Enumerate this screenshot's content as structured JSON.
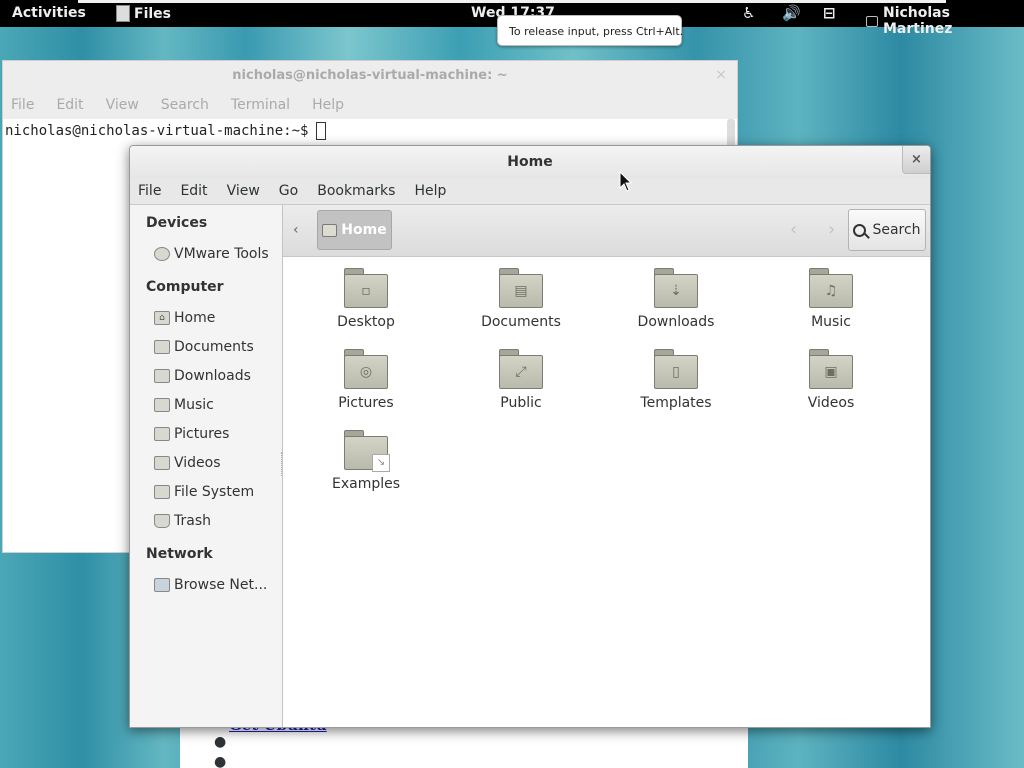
{
  "topbar": {
    "activities": "Activities",
    "app_menu": "Files",
    "clock": "Wed 17:37",
    "user_name": "Nicholas Martinez",
    "tray_icons": [
      "accessibility-icon",
      "volume-icon",
      "network-icon",
      "user-status-icon"
    ]
  },
  "tooltip": {
    "text": "To release input, press Ctrl+Alt."
  },
  "background_page": {
    "link_text": "Get Ubuntu"
  },
  "terminal": {
    "title": "nicholas@nicholas-virtual-machine: ~",
    "close": "×",
    "menu": [
      "File",
      "Edit",
      "View",
      "Search",
      "Terminal",
      "Help"
    ],
    "prompt": "nicholas@nicholas-virtual-machine:~$"
  },
  "nautilus": {
    "title": "Home",
    "close": "×",
    "menu": [
      "File",
      "Edit",
      "View",
      "Go",
      "Bookmarks",
      "Help"
    ],
    "sidebar": {
      "devices_heading": "Devices",
      "devices": [
        {
          "label": "VMware Tools",
          "icon": "disc-icon"
        }
      ],
      "computer_heading": "Computer",
      "computer": [
        {
          "label": "Home",
          "icon": "home-folder-icon"
        },
        {
          "label": "Documents",
          "icon": "documents-folder-icon"
        },
        {
          "label": "Downloads",
          "icon": "downloads-folder-icon"
        },
        {
          "label": "Music",
          "icon": "music-folder-icon"
        },
        {
          "label": "Pictures",
          "icon": "pictures-folder-icon"
        },
        {
          "label": "Videos",
          "icon": "videos-folder-icon"
        },
        {
          "label": "File System",
          "icon": "filesystem-icon"
        },
        {
          "label": "Trash",
          "icon": "trash-icon"
        }
      ],
      "network_heading": "Network",
      "network": [
        {
          "label": "Browse Net...",
          "icon": "network-browse-icon"
        }
      ]
    },
    "toolbar": {
      "path_label": "Home",
      "search_label": "Search",
      "back_label": "‹",
      "nav_back": "‹",
      "nav_forward": "›"
    },
    "files": [
      {
        "label": "Desktop",
        "glyph": "▫"
      },
      {
        "label": "Documents",
        "glyph": "▤"
      },
      {
        "label": "Downloads",
        "glyph": "⇣"
      },
      {
        "label": "Music",
        "glyph": "♫"
      },
      {
        "label": "Pictures",
        "glyph": "◎"
      },
      {
        "label": "Public",
        "glyph": "⤢"
      },
      {
        "label": "Templates",
        "glyph": "▯"
      },
      {
        "label": "Videos",
        "glyph": "▣"
      },
      {
        "label": "Examples",
        "glyph": ""
      }
    ]
  }
}
